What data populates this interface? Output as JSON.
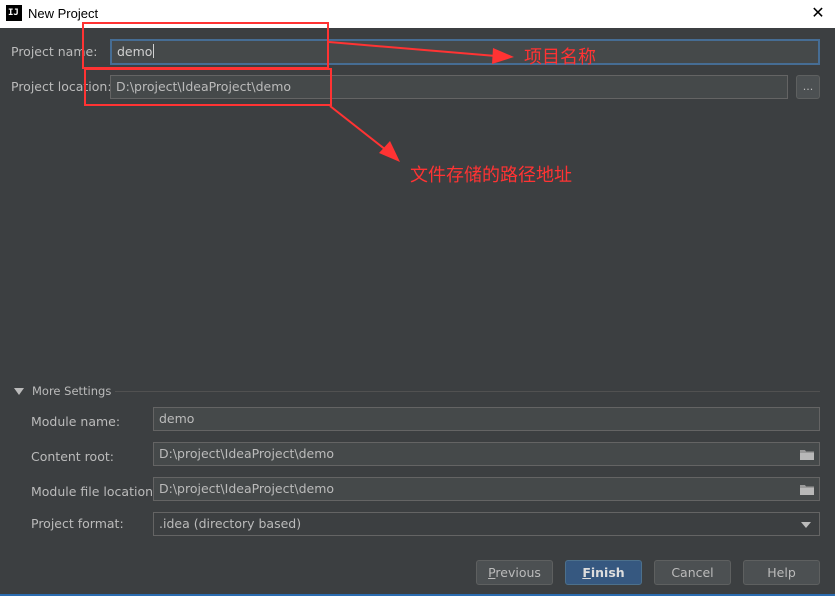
{
  "window": {
    "title": "New Project",
    "app_icon_text": "IJ",
    "close_glyph": "✕"
  },
  "form": {
    "project_name_label": "Project name:",
    "project_name_value": "demo",
    "project_location_label": "Project location:",
    "project_location_value": "D:\\project\\IdeaProject\\demo",
    "browse_label": "..."
  },
  "annotations": {
    "name_note": "项目名称",
    "location_note": "文件存储的路径地址"
  },
  "more_settings": {
    "header": "More Settings",
    "module_name_label": "Module name:",
    "module_name_value": "demo",
    "content_root_label": "Content root:",
    "content_root_value": "D:\\project\\IdeaProject\\demo",
    "module_file_label": "Module file location:",
    "module_file_value": "D:\\project\\IdeaProject\\demo",
    "project_format_label": "Project format:",
    "project_format_value": ".idea (directory based)"
  },
  "buttons": {
    "previous_first": "P",
    "previous_rest": "revious",
    "finish_first": "F",
    "finish_rest": "inish",
    "cancel": "Cancel",
    "help": "Help"
  },
  "icons": {
    "close": "close-icon",
    "folder": "folder-icon",
    "collapse": "triangle-down-icon",
    "dropdown": "chevron-down-icon"
  },
  "colors": {
    "background": "#3c3f41",
    "field": "#45494a",
    "focus_border": "#466d94",
    "annotation": "#ff3333",
    "default_button": "#365880"
  }
}
